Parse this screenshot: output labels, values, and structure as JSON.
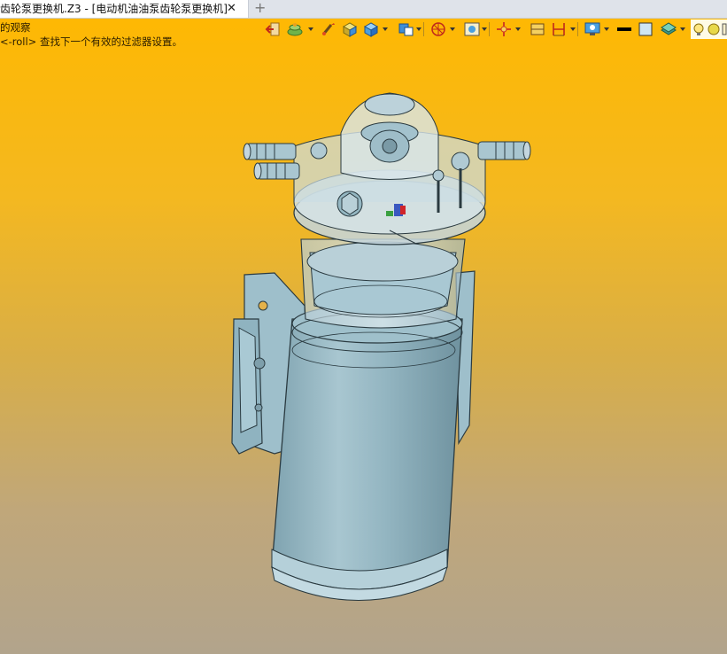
{
  "window": {
    "tab_title": "齿轮泵更换机.Z3 - [电动机油油泵齿轮泵更换机]",
    "close_glyph": "✕",
    "add_tab_glyph": "+"
  },
  "messages": {
    "line1": "的观察",
    "line2": "<-roll> 查找下一个有效的过滤器设置。"
  },
  "toolbar": {
    "items": [
      {
        "icon": "exit-icon"
      },
      {
        "icon": "layer-manager-icon"
      },
      {
        "icon": "brush-icon"
      },
      {
        "icon": "shaded-box-icon"
      },
      {
        "icon": "cube-view-icon"
      },
      {
        "icon": "view-orient-icon"
      },
      {
        "icon": "filter-icon"
      },
      {
        "icon": "render-mode-icon"
      },
      {
        "icon": "snap-icon"
      },
      {
        "icon": "section-icon"
      },
      {
        "icon": "measure-icon"
      },
      {
        "icon": "display-settings-icon"
      },
      {
        "icon": "line-style-icon"
      },
      {
        "icon": "color-swatch-icon"
      },
      {
        "icon": "material-icon"
      },
      {
        "icon": "light-bulb-icon"
      }
    ]
  },
  "colors": {
    "background_top": "#ffb800",
    "background_bottom": "#b2a48c",
    "model_steel": "#8fb3c0",
    "model_glass": "#c4d6de"
  },
  "viewport": {
    "model_label": "电动机油油泵齿轮泵更换机"
  }
}
